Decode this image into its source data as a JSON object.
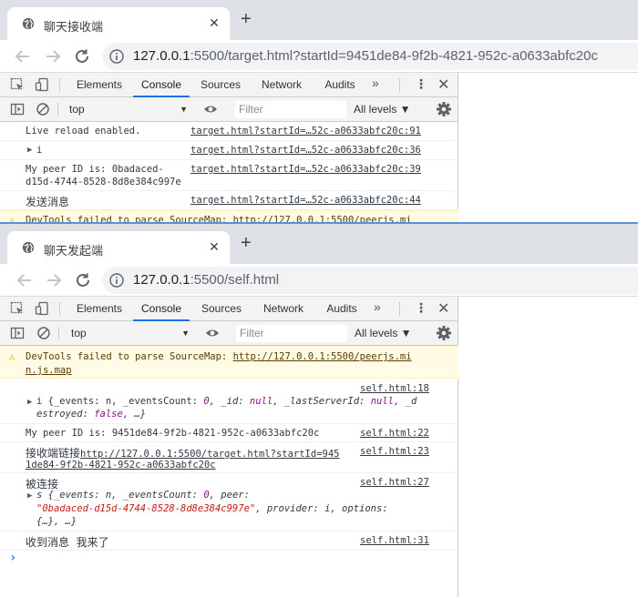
{
  "win1": {
    "tab_title": "聊天接收端",
    "url_host": "127.0.0.1",
    "url_rest": ":5500/target.html?startId=9451de84-9f2b-4821-952c-a0633abfc20c",
    "devtools": {
      "tabs": [
        "Elements",
        "Console",
        "Sources",
        "Network",
        "Audits"
      ],
      "more": "»",
      "context": "top",
      "filter_placeholder": "Filter",
      "levels": "All levels ▼",
      "logs": [
        {
          "msg": "Live reload enabled.",
          "src": "target.html?startId=…52c-a0633abfc20c:91"
        },
        {
          "msg": "i",
          "src": "target.html?startId=…52c-a0633abfc20c:36"
        },
        {
          "msg1": "My peer ID is: 0badaced-",
          "msg2": "d15d-4744-8528-8d8e384c997e",
          "src": "target.html?startId=…52c-a0633abfc20c:39"
        },
        {
          "msg": "发送消息",
          "src": "target.html?startId=…52c-a0633abfc20c:44"
        },
        {
          "msg": "DevTools failed to parse SourceMap: http://127.0.0.1:5500/peerjs.mi"
        }
      ]
    }
  },
  "win2": {
    "tab_title": "聊天发起端",
    "url_host": "127.0.0.1",
    "url_rest": ":5500/self.html",
    "devtools": {
      "tabs": [
        "Elements",
        "Console",
        "Sources",
        "Network",
        "Audits"
      ],
      "more": "»",
      "context": "top",
      "filter_placeholder": "Filter",
      "levels": "All levels ▼",
      "warning": {
        "prefix": "DevTools failed to parse SourceMap: ",
        "link1": "http://127.0.0.1:5500/peerjs.mi",
        "link2": "n.js.map"
      },
      "log1": {
        "src": "self.html:18",
        "l1a": "i {_events: n, _eventsCount: ",
        "l1b": "0",
        "l1c": ", _id: ",
        "l1d": "null",
        "l1e": ", _lastServerId: ",
        "l1f": "null",
        "l1g": ", _d",
        "l2a": "estroyed: ",
        "l2b": "false",
        "l2c": ", …}"
      },
      "log2": {
        "msg": "My peer ID is: 9451de84-9f2b-4821-952c-a0633abfc20c",
        "src": "self.html:22"
      },
      "log3": {
        "prefix": "接收端链接",
        "link1": "http://127.0.0.1:5500/target.html?startId=945",
        "link2": "1de84-9f2b-4821-952c-a0633abfc20c",
        "src": "self.html:23"
      },
      "log4": {
        "msg": "被连接",
        "src": "self.html:27",
        "l1a": "s {_events: n, _eventsCount: ",
        "l1b": "0",
        "l1c": ", peer:",
        "l2a": "\"0badaced-d15d-4744-8528-8d8e384c997e\"",
        "l2b": ", provider: i, options:",
        "l3": "{…}, …}"
      },
      "log5": {
        "msg": "收到消息  我来了",
        "src": "self.html:31"
      },
      "prompt": "›"
    }
  }
}
